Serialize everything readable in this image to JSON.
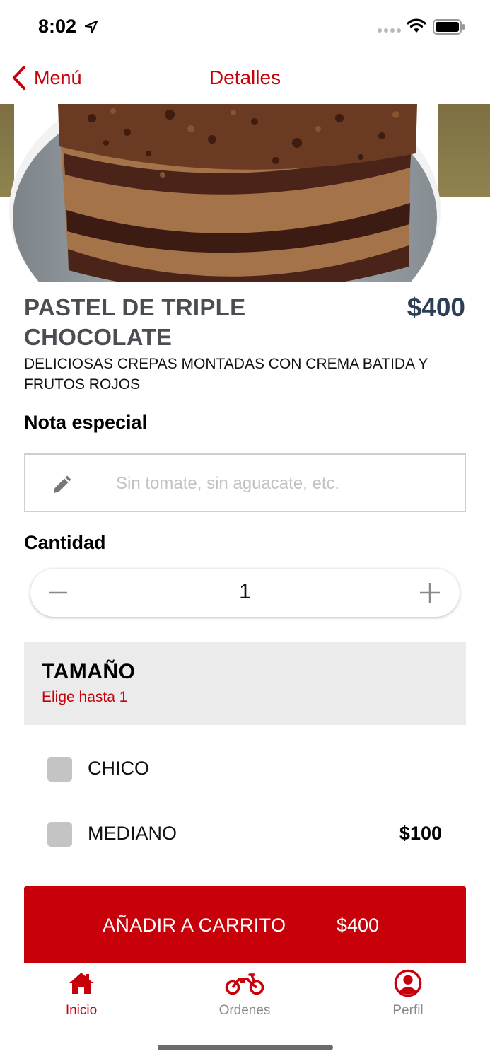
{
  "status_bar": {
    "time": "8:02"
  },
  "nav": {
    "back_label": "Menú",
    "title": "Detalles"
  },
  "product": {
    "name": "PASTEL DE TRIPLE CHOCOLATE",
    "price": "$400",
    "description": "DELICIOSAS CREPAS MONTADAS CON CREMA BATIDA Y FRUTOS ROJOS"
  },
  "note": {
    "label": "Nota especial",
    "placeholder": "Sin tomate, sin aguacate, etc.",
    "value": ""
  },
  "quantity": {
    "label": "Cantidad",
    "value": "1"
  },
  "options": {
    "title": "TAMAÑO",
    "subtitle": "Elige hasta 1",
    "items": [
      {
        "label": "CHICO",
        "price": "",
        "selected": false
      },
      {
        "label": "MEDIANO",
        "price": "$100",
        "selected": false
      }
    ]
  },
  "add_to_cart": {
    "label": "AÑADIR A CARRITO",
    "price": "$400"
  },
  "tabs": [
    {
      "label": "Inicio",
      "icon": "home-icon",
      "active": true
    },
    {
      "label": "Ordenes",
      "icon": "motorcycle-icon",
      "active": false
    },
    {
      "label": "Perfil",
      "icon": "user-circle-icon",
      "active": false
    }
  ],
  "colors": {
    "accent": "#c8000a",
    "price_text": "#2d3f57",
    "option_header_bg": "#ebebeb",
    "checkbox": "#c4c4c4"
  }
}
